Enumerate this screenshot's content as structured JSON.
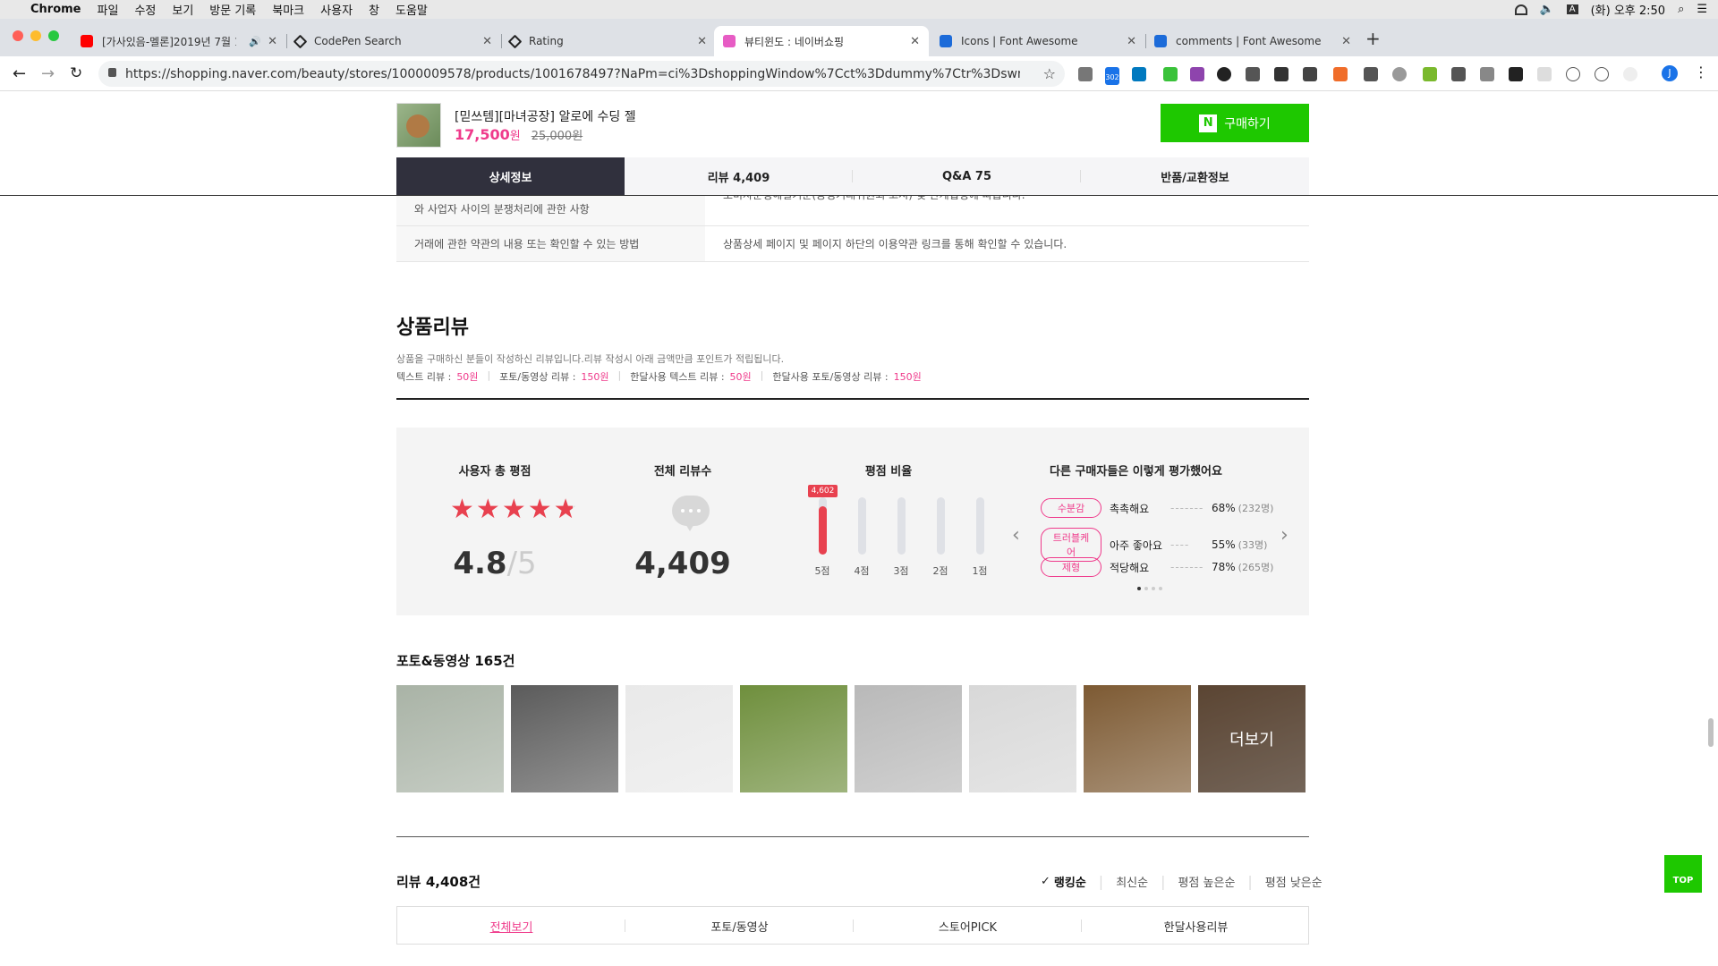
{
  "menubar": {
    "app": "Chrome",
    "items": [
      "파일",
      "수정",
      "보기",
      "방문 기록",
      "북마크",
      "사용자",
      "창",
      "도움말"
    ],
    "clock": "(화) 오후 2:50"
  },
  "tabs": [
    {
      "title": "[가사있음-멜론]2019년 7월 1...",
      "icon": "youtube-icon",
      "color": "#ff0000"
    },
    {
      "title": "CodePen Search",
      "icon": "codepen-icon",
      "color": "#222222"
    },
    {
      "title": "Rating",
      "icon": "codepen-icon",
      "color": "#222222"
    },
    {
      "title": "뷰티윈도 : 네이버쇼핑",
      "icon": "naver-beauty-icon",
      "color": "#e75cc4"
    },
    {
      "title": "Icons | Font Awesome",
      "icon": "font-awesome-icon",
      "color": "#1c6bd9"
    },
    {
      "title": "comments | Font Awesome",
      "icon": "font-awesome-icon",
      "color": "#1c6bd9"
    }
  ],
  "address": {
    "url": "https://shopping.naver.com/beauty/stores/1000009578/products/1001678497?NaPm=ci%3DshoppingWindow%7Cct%3Ddummy%7Ctr%3Dswne%7Ch...",
    "badge": "302",
    "avatar_letter": "J"
  },
  "product_header": {
    "name": "[믿쓰템][마녀공장] 알로에 수딩 젤",
    "price": "17,500",
    "price_unit": "원",
    "original_price": "25,000원",
    "buy_button_icon": "N",
    "buy_button_label": "구매하기"
  },
  "content_tabs": [
    {
      "label": "상세정보",
      "active": true
    },
    {
      "label": "리뷰 4,409",
      "active": false
    },
    {
      "label": "Q&A 75",
      "active": false
    },
    {
      "label": "반품/교환정보",
      "active": false
    }
  ],
  "info_rows": [
    {
      "th": "와 사업자 사이의 분쟁처리에 관한 사항",
      "td": "소비자분쟁해결기준(공정거래위원회 고시) 및 관계법령에 따릅니다."
    },
    {
      "th": "거래에 관한 약관의 내용 또는 확인할 수 있는 방법",
      "td": "상품상세 페이지 및 페이지 하단의 이용약관 링크를 통해 확인할 수 있습니다."
    }
  ],
  "review_section": {
    "title": "상품리뷰",
    "description": "상품을 구매하신 분들이 작성하신 리뷰입니다.리뷰 작성시 아래 금액만큼 포인트가 적립됩니다.",
    "points": [
      {
        "label": "텍스트 리뷰 :",
        "value": "50원"
      },
      {
        "label": "포토/동영상 리뷰 :",
        "value": "150원"
      },
      {
        "label": "한달사용 텍스트 리뷰 :",
        "value": "50원"
      },
      {
        "label": "한달사용 포토/동영상 리뷰 :",
        "value": "150원"
      }
    ]
  },
  "summary": {
    "rating_title": "사용자 총 평점",
    "rating": "4.8",
    "rating_max": "/5",
    "rating_value": 4.8,
    "count_title": "전체 리뷰수",
    "count": "4,409",
    "ratio_title": "평점 비율",
    "bars": [
      {
        "label": "5점",
        "fraction": 0.85,
        "badge": "4,602",
        "color": "#e8414f"
      },
      {
        "label": "4점",
        "fraction": 0.0,
        "color": "#dfe1e6"
      },
      {
        "label": "3점",
        "fraction": 0.0,
        "color": "#dfe1e6"
      },
      {
        "label": "2점",
        "fraction": 0.0,
        "color": "#dfe1e6"
      },
      {
        "label": "1점",
        "fraction": 0.0,
        "color": "#dfe1e6"
      }
    ],
    "others_title": "다른 구매자들은 이렇게 평가했어요",
    "attributes": [
      {
        "tag": "수분감",
        "value": "촉촉해요",
        "percent": "68%",
        "count": "(232명)"
      },
      {
        "tag": "트러블케어",
        "value": "아주 좋아요",
        "percent": "55%",
        "count": "(33명)"
      },
      {
        "tag": "제형",
        "value": "적당해요",
        "percent": "78%",
        "count": "(265명)"
      }
    ]
  },
  "photo_section": {
    "title": "포토&동영상",
    "count": "165건",
    "more_label": "더보기",
    "thumbs": [
      {
        "name": "photo-thumb-bottle-closeup",
        "color": "#a9b3a6"
      },
      {
        "name": "photo-thumb-bottle-desk",
        "color": "#5b5b5b"
      },
      {
        "name": "photo-thumb-ad-screenshot",
        "color": "#e9e9e9"
      },
      {
        "name": "photo-thumb-dog-grass",
        "color": "#6f8f3d"
      },
      {
        "name": "photo-thumb-products-table",
        "color": "#b9b9b9"
      },
      {
        "name": "photo-thumb-swatches",
        "color": "#d8d8d8"
      },
      {
        "name": "photo-thumb-bottle-wood",
        "color": "#7d5a33"
      },
      {
        "name": "photo-thumb-bottle-label",
        "color": "#8c6a4e"
      }
    ]
  },
  "review_list": {
    "title": "리뷰 4,408건",
    "sort_options": [
      "랭킹순",
      "최신순",
      "평점 높은순",
      "평점 낮은순"
    ],
    "sort_active": 0,
    "tabs": [
      "전체보기",
      "포토/동영상",
      "스토어PICK",
      "한달사용리뷰"
    ],
    "tab_active": 0
  },
  "top_button": "TOP",
  "colors": {
    "accent_pink": "#ef3a8b",
    "buy_green": "#1ec800",
    "dark_tab": "#30303d",
    "star_red": "#e8414f"
  }
}
